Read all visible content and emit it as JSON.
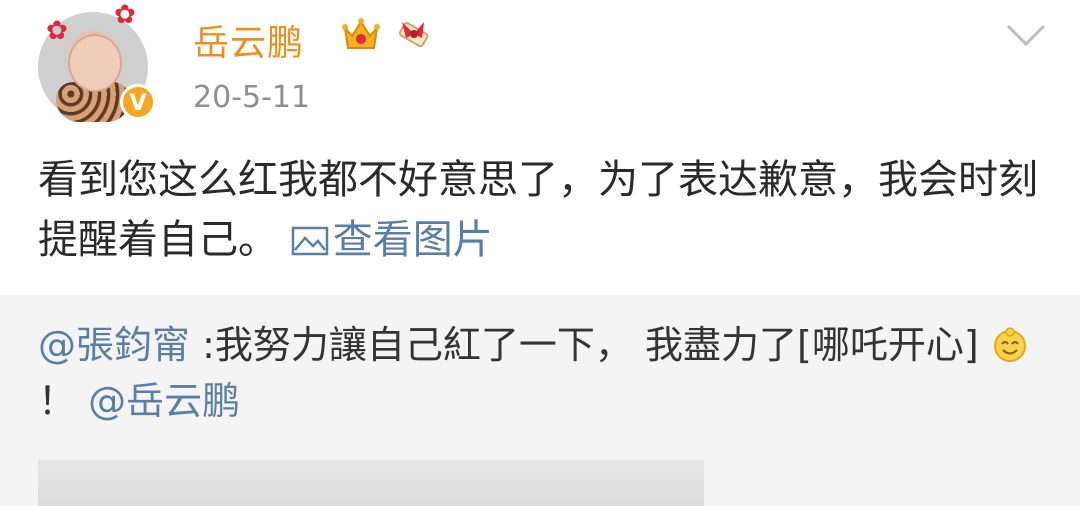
{
  "post": {
    "username": "岳云鹏",
    "timestamp": "20-5-11",
    "verified_badge": "V",
    "content": "看到您这么红我都不好意思了，为了表达歉意，我会时刻提醒着自己。",
    "view_pictures_label": "查看图片",
    "icons": [
      "crown-icon",
      "scroll-bow-icon",
      "chevron-down-icon",
      "picture-icon"
    ]
  },
  "repost": {
    "mention_author": "@張鈞甯",
    "text": ":我努力讓自己紅了一下， 我盡力了[哪吒开心]",
    "exclamation": "！",
    "mention_target": "@岳云鹏",
    "emoji": "nezha-happy-emoji"
  },
  "colors": {
    "username": "#f08e1c",
    "link": "#5a7fa6",
    "timestamp": "#8f8f8f",
    "repost_bg": "#f4f4f4"
  }
}
